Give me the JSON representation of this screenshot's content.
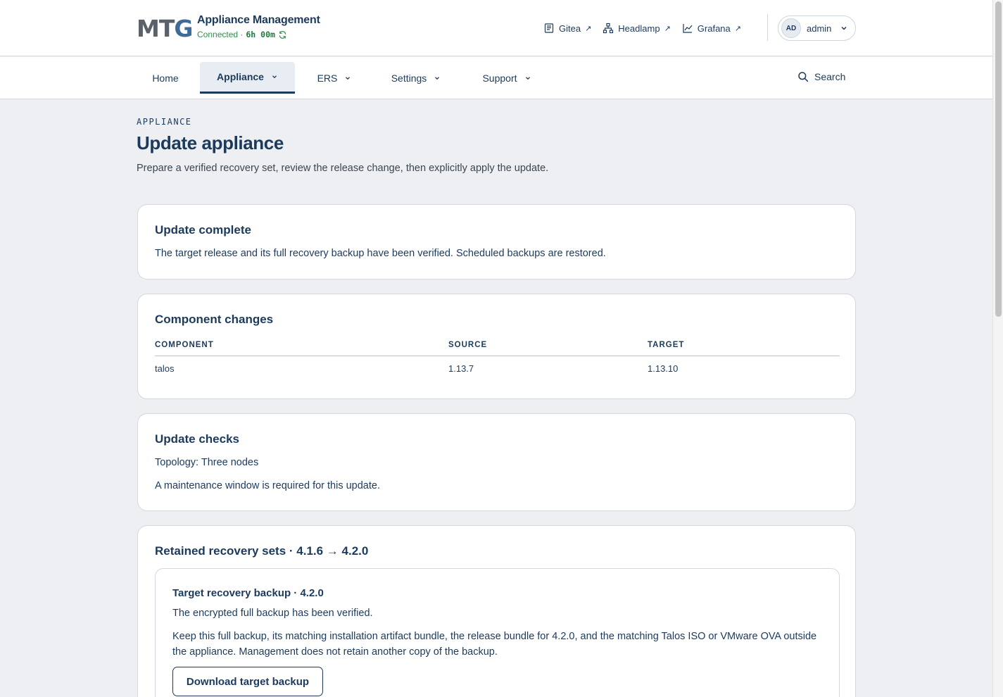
{
  "header": {
    "logo": {
      "m": "MT",
      "g": "G"
    },
    "app_title": "Appliance Management",
    "connection_label": "Connected ·",
    "connection_timer": "6h 00m",
    "links": [
      {
        "label": "Gitea",
        "icon": "document-icon"
      },
      {
        "label": "Headlamp",
        "icon": "network-icon"
      },
      {
        "label": "Grafana",
        "icon": "chart-icon"
      }
    ],
    "external_glyph": "↗",
    "user": {
      "initials": "AD",
      "name": "admin"
    }
  },
  "nav": {
    "items": [
      {
        "label": "Home"
      },
      {
        "label": "Appliance"
      },
      {
        "label": "ERS"
      },
      {
        "label": "Settings"
      },
      {
        "label": "Support"
      }
    ],
    "active": "Appliance",
    "search_label": "Search"
  },
  "page": {
    "eyebrow": "APPLIANCE",
    "title": "Update appliance",
    "description": "Prepare a verified recovery set, review the release change, then explicitly apply the update."
  },
  "update_complete": {
    "title": "Update complete",
    "message": "The target release and its full recovery backup have been verified. Scheduled backups are restored."
  },
  "component_changes": {
    "title": "Component changes",
    "columns": [
      "COMPONENT",
      "SOURCE",
      "TARGET"
    ],
    "rows": [
      {
        "component": "talos",
        "source": "1.13.7",
        "target": "1.13.10"
      }
    ]
  },
  "update_checks": {
    "title": "Update checks",
    "topology": "Topology: Three nodes",
    "maintenance": "A maintenance window is required for this update."
  },
  "recovery_sets": {
    "title": "Retained recovery sets · 4.1.6 → 4.2.0",
    "target": {
      "title": "Target recovery backup · 4.2.0",
      "status": "The encrypted full backup has been verified.",
      "instructions": "Keep this full backup, its matching installation artifact bundle, the release bundle for 4.2.0, and the matching Talos ISO or VMware OVA outside the appliance. Management does not retain another copy of the backup.",
      "button": "Download target backup"
    }
  },
  "colors": {
    "primary": "#1b3a5c",
    "connected": "#2f8f4e",
    "background": "#edeff2",
    "card": "#ffffff",
    "border": "#d3d8de"
  }
}
